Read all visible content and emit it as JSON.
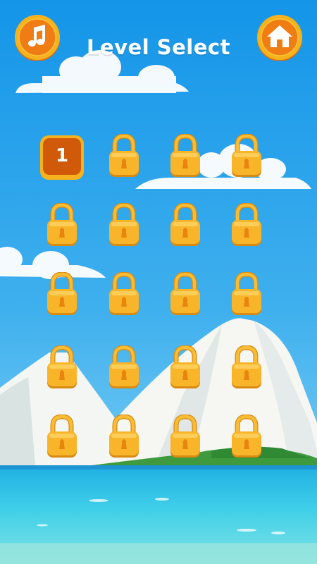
{
  "header": {
    "title": "Level Select",
    "music_button": {
      "icon": "music-note-icon"
    },
    "home_button": {
      "icon": "home-icon"
    }
  },
  "levels": [
    {
      "number": "1",
      "locked": false
    },
    {
      "number": "",
      "locked": true
    },
    {
      "number": "",
      "locked": true
    },
    {
      "number": "",
      "locked": true
    },
    {
      "number": "",
      "locked": true
    },
    {
      "number": "",
      "locked": true
    },
    {
      "number": "",
      "locked": true
    },
    {
      "number": "",
      "locked": true
    },
    {
      "number": "",
      "locked": true
    },
    {
      "number": "",
      "locked": true
    },
    {
      "number": "",
      "locked": true
    },
    {
      "number": "",
      "locked": true
    },
    {
      "number": "",
      "locked": true
    },
    {
      "number": "",
      "locked": true
    },
    {
      "number": "",
      "locked": true
    },
    {
      "number": "",
      "locked": true
    },
    {
      "number": "",
      "locked": true
    },
    {
      "number": "",
      "locked": true
    },
    {
      "number": "",
      "locked": true
    },
    {
      "number": "",
      "locked": true
    }
  ],
  "colors": {
    "sky_top": "#1796e8",
    "sky_bottom": "#7ecff5",
    "button_orange": "#f07d13",
    "button_ring": "#f6b21c",
    "tile_unlocked": "#d15a0a",
    "lock_gold": "#f8b52a",
    "keyhole": "#e8850f",
    "sea": "#35c3e8"
  }
}
